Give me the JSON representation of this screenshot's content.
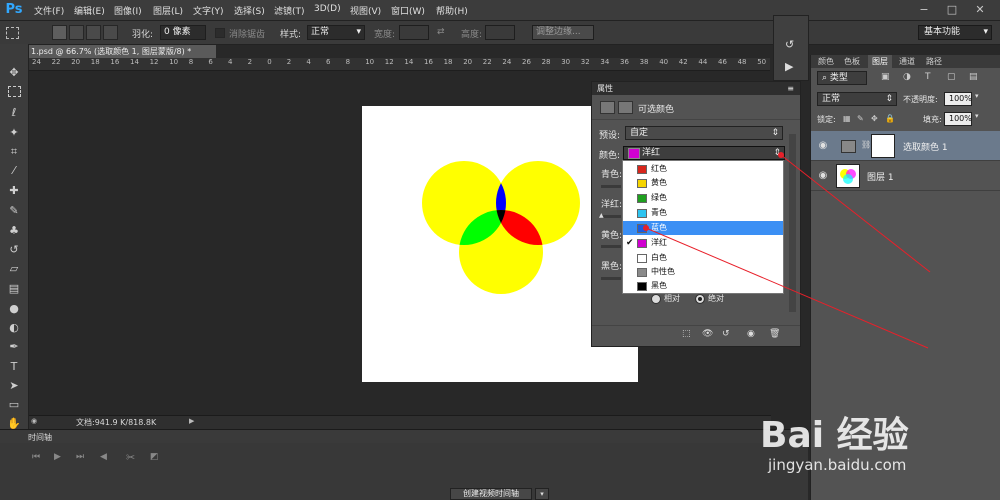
{
  "app": {
    "logo": "Ps"
  },
  "menu": [
    "文件(F)",
    "编辑(E)",
    "图像(I)",
    "图层(L)",
    "文字(Y)",
    "选择(S)",
    "滤镜(T)",
    "3D(D)",
    "视图(V)",
    "窗口(W)",
    "帮助(H)"
  ],
  "window_controls": [
    "−",
    "□",
    "✕"
  ],
  "options": {
    "feather_label": "羽化:",
    "feather_value": "0 像素",
    "antialias": "消除锯齿",
    "style_label": "样式:",
    "style_value": "正常",
    "width_label": "宽度:",
    "height_label": "高度:",
    "refine_edge": "调整边缘...",
    "workspace": "基本功能"
  },
  "document": {
    "tab": "1.psd @ 66.7% (选取颜色 1, 图层蒙版/8) *",
    "status": "文档:941.9 K/818.8K",
    "ruler_ticks": [
      "24",
      "22",
      "20",
      "18",
      "16",
      "14",
      "12",
      "10",
      "8",
      "6",
      "4",
      "2",
      "0",
      "2",
      "4",
      "6",
      "8",
      "10",
      "12",
      "14",
      "16",
      "18",
      "20",
      "22",
      "24",
      "26",
      "28",
      "30",
      "32",
      "34",
      "36",
      "38",
      "40",
      "42",
      "44",
      "46",
      "48",
      "50"
    ]
  },
  "timeline": {
    "tab": "时间轴",
    "create_button": "创建视频时间轴"
  },
  "properties": {
    "panel_title": "属性",
    "adjustment_title": "可选颜色",
    "preset_label": "预设:",
    "preset_value": "自定",
    "colors_label": "颜色:",
    "colors_value": "洋红",
    "sliders": [
      "青色:",
      "洋红:",
      "黄色:",
      "黑色:"
    ],
    "method_relative": "相对",
    "method_absolute": "绝对",
    "dropdown_items": [
      {
        "label": "红色",
        "color": "#d8261c"
      },
      {
        "label": "黄色",
        "color": "#f5d400"
      },
      {
        "label": "绿色",
        "color": "#1fa01f"
      },
      {
        "label": "青色",
        "color": "#2ec4f0"
      },
      {
        "label": "蓝色",
        "color": "#1a5ce0"
      },
      {
        "label": "洋红",
        "color": "#d000d0"
      },
      {
        "label": "白色",
        "color": "#ffffff"
      },
      {
        "label": "中性色",
        "color": "#8a8a8a"
      },
      {
        "label": "黑色",
        "color": "#000000"
      }
    ],
    "dropdown_hover": "蓝色",
    "dropdown_checked": "洋红"
  },
  "layers": {
    "tabs": [
      "颜色",
      "色板",
      "图层",
      "通道",
      "路径"
    ],
    "kind_filter": "类型",
    "blend_mode": "正常",
    "opacity_label": "不透明度:",
    "opacity_value": "100%",
    "lock_label": "锁定:",
    "fill_label": "填充:",
    "fill_value": "100%",
    "items": [
      {
        "name": "选取颜色 1"
      },
      {
        "name": "图层 1"
      }
    ]
  },
  "watermark": {
    "logo": "Bai 经验",
    "url": "jingyan.baidu.com"
  },
  "colors": {
    "circle_yellow": "#ffff00",
    "overlap_blue": "#0000ff",
    "overlap_green": "#00ff00",
    "overlap_red": "#ff0000",
    "center_black": "#000000",
    "annotation_red": "#e8202a"
  }
}
